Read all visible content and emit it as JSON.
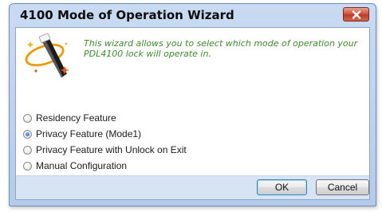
{
  "window": {
    "title": "4100 Mode of Operation Wizard"
  },
  "icons": {
    "close": "close-x-icon",
    "wizard": "magic-wand-icon"
  },
  "description": "This wizard allows you to select which mode of operation your PDL4100 lock will operate in.",
  "options": [
    {
      "label": "Residency Feature",
      "selected": false
    },
    {
      "label": "Privacy Feature (Mode1)",
      "selected": true
    },
    {
      "label": "Privacy Feature with Unlock on Exit",
      "selected": false
    },
    {
      "label": "Manual Configuration",
      "selected": false
    }
  ],
  "buttons": {
    "ok": "OK",
    "cancel": "Cancel"
  },
  "colors": {
    "description_text": "#3c8a2c",
    "close_button": "#c8462f",
    "frame": "#b4cbe9"
  }
}
